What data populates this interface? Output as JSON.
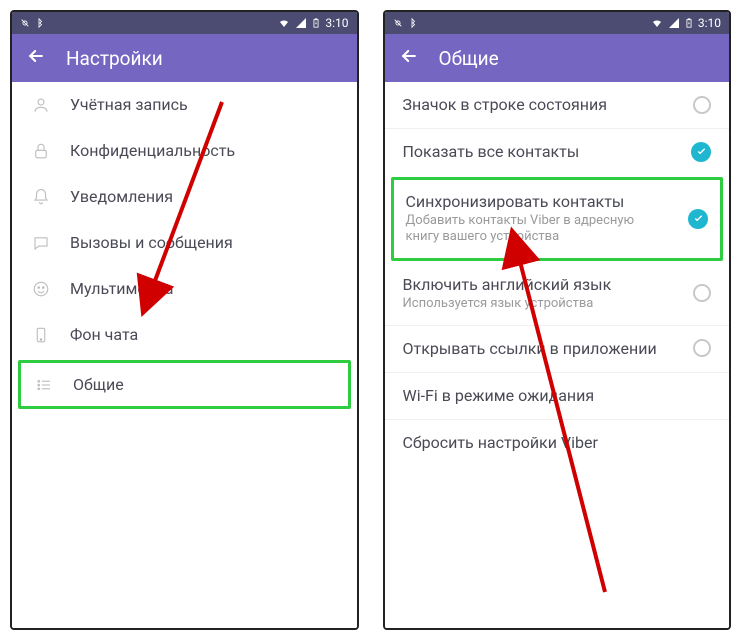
{
  "status": {
    "time": "3:10"
  },
  "screen1": {
    "title": "Настройки",
    "items": [
      {
        "icon": "user",
        "label": "Учётная запись"
      },
      {
        "icon": "lock",
        "label": "Конфиденциальность"
      },
      {
        "icon": "bell",
        "label": "Уведомления"
      },
      {
        "icon": "chat",
        "label": "Вызовы и сообщения"
      },
      {
        "icon": "media",
        "label": "Мультимедиа"
      },
      {
        "icon": "phone",
        "label": "Фон чата"
      },
      {
        "icon": "list",
        "label": "Общие"
      }
    ]
  },
  "screen2": {
    "title": "Общие",
    "items": [
      {
        "label": "Значок в строке состояния",
        "control": "radio-off"
      },
      {
        "label": "Показать все контакты",
        "control": "check-on"
      },
      {
        "label": "Синхронизировать контакты",
        "sub": "Добавить контакты Viber в адресную книгу вашего устройства",
        "control": "check-on",
        "highlight": true
      },
      {
        "label": "Включить английский язык",
        "sub": "Используется язык устройства",
        "control": "radio-off"
      },
      {
        "label": "Открывать ссылки в приложении",
        "control": "radio-off"
      },
      {
        "label": "Wi-Fi в режиме ожидания"
      },
      {
        "label": "Сбросить настройки Viber"
      }
    ]
  }
}
